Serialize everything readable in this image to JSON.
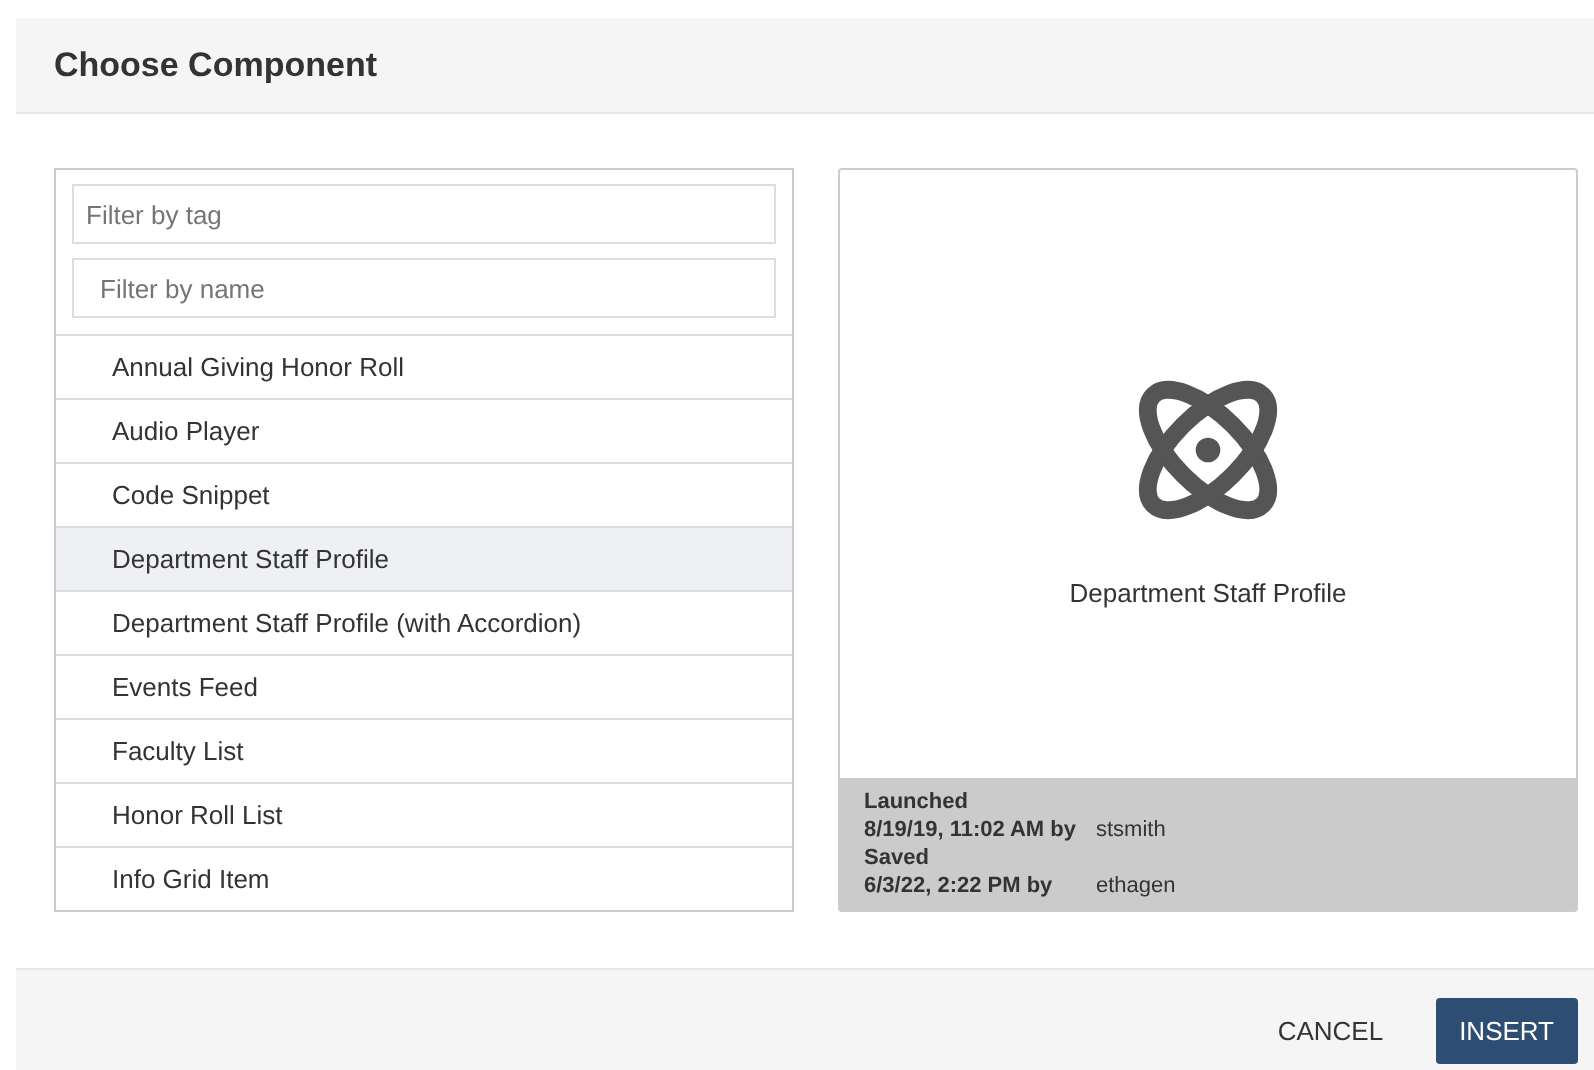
{
  "dialog": {
    "title": "Choose Component"
  },
  "filters": [
    {
      "placeholder": "Filter by tag"
    },
    {
      "placeholder": "Filter by name"
    }
  ],
  "components": [
    {
      "label": "Annual Giving Honor Roll",
      "selected": false
    },
    {
      "label": "Audio Player",
      "selected": false
    },
    {
      "label": "Code Snippet",
      "selected": false
    },
    {
      "label": "Department Staff Profile",
      "selected": true
    },
    {
      "label": "Department Staff Profile (with Accordion)",
      "selected": false
    },
    {
      "label": "Events Feed",
      "selected": false
    },
    {
      "label": "Faculty List",
      "selected": false
    },
    {
      "label": "Honor Roll List",
      "selected": false
    },
    {
      "label": "Info Grid Item",
      "selected": false
    }
  ],
  "preview": {
    "name": "Department Staff Profile",
    "meta": [
      {
        "heading": "Launched",
        "when": "8/19/19, 11:02 AM by",
        "user": "stsmith"
      },
      {
        "heading": "Saved",
        "when": "6/3/22, 2:22 PM by",
        "user": "ethagen"
      }
    ]
  },
  "buttons": [
    {
      "label": "CANCEL",
      "kind": "flat"
    },
    {
      "label": "INSERT",
      "kind": "primary"
    }
  ]
}
